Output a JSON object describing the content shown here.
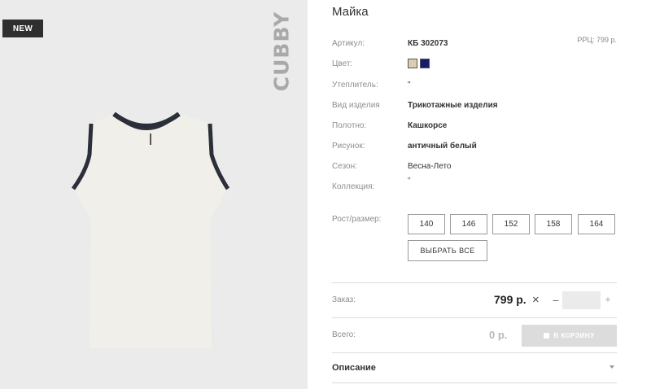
{
  "badge": {
    "new_label": "NEW"
  },
  "brand": {
    "name": "CUBBY"
  },
  "product": {
    "title": "Майка",
    "rrp": "РРЦ: 799 р."
  },
  "attributes": {
    "article": {
      "label": "Артикул:",
      "value": "КБ 302073"
    },
    "color": {
      "label": "Цвет:",
      "swatches": [
        "#d9cdb4",
        "#1a1a6e"
      ]
    },
    "insulation": {
      "label": "Утеплитель:",
      "value": "\""
    },
    "type": {
      "label": "Вид изделия",
      "value": "Трикотажные изделия"
    },
    "fabric": {
      "label": "Полотно:",
      "value": "Кашкорсе"
    },
    "pattern": {
      "label": "Рисунок:",
      "value": "античный белый"
    },
    "season": {
      "label": "Сезон:",
      "value": "Весна-Лето"
    },
    "collection": {
      "label": "Коллекция:",
      "value": "\""
    }
  },
  "sizes": {
    "label": "Рост/размер:",
    "options": [
      "140",
      "146",
      "152",
      "158",
      "164"
    ],
    "select_all": "ВЫБРАТЬ ВСЕ"
  },
  "order": {
    "label": "Заказ:",
    "price": "799 р.",
    "times_icon": "×",
    "minus": "−",
    "plus": "+",
    "quantity": ""
  },
  "total": {
    "label": "Всего:",
    "price": "0 р.",
    "cart_button": "В КОРЗИНУ"
  },
  "description": {
    "label": "Описание"
  },
  "icons": {
    "times": "close-icon",
    "cart": "lock-icon",
    "dropdown": "chevron-down-icon"
  }
}
